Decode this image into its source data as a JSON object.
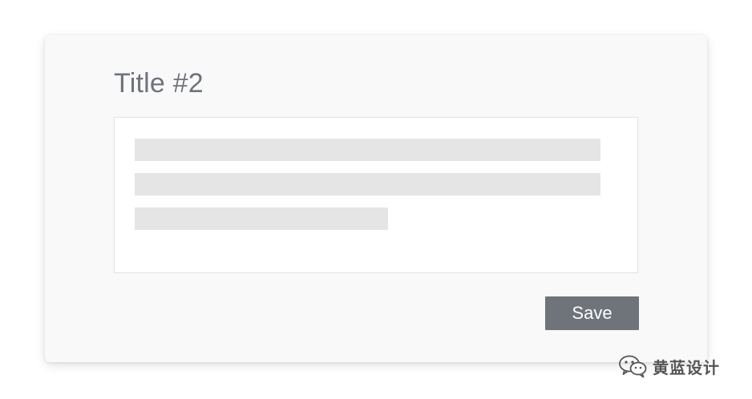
{
  "card": {
    "title": "Title #2",
    "placeholder_lines": 3,
    "save_label": "Save"
  },
  "watermark": {
    "icon": "wechat-icon",
    "text": "黄蓝设计"
  },
  "colors": {
    "title": "#6f737a",
    "button_bg": "#6f737a",
    "card_bg": "#f9f9f9",
    "placeholder": "#e5e5e5"
  }
}
